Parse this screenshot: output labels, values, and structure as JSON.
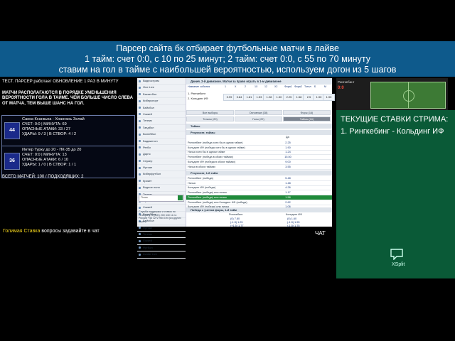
{
  "banner": {
    "line1": "Парсер сайта бк отбирает футбольные матчи в лайве",
    "line2": "1 тайм: счет 0:0, с 10 по 25 минут; 2 тайм: счет 0:0, с 55 по 70 минуту",
    "line3": "ставим на гол в тайме с наибольшей вероятностью, используем догон из 5 шагов"
  },
  "parser": {
    "status": "ТЕСТ. ПАРСЕР работает ОБНОВЛЕНИЕ 1 РАЗ В МИНУТУ",
    "note": "МАТЧИ РАСПОЛАГАЮТСЯ В ПОРЯДКЕ УМЕНЬШЕНИЯ ВЕРОЯТНОСТИ ГОЛА В ТАЙМЕ. ЧЕМ БОЛЬШЕ ЧИСЛО СЛЕВА ОТ МАТЧА, ТЕМ ВЫШЕ ШАНС НА ГОЛ.",
    "matches": [
      {
        "num": "44",
        "teams": "Санка Ксанкьоа - Хоангань Зелай",
        "score": "СЧЕТ: 0:0 | МИНУТА: 69",
        "attacks": "ОПАСНЫЕ АТАКИ: 33 / 27",
        "shots": "УДАРЫ: 9 / 3 | В СТВОР: 4 / 2"
      },
      {
        "num": "36",
        "teams": "Интер Турку до 20 - ПК-35 до 20",
        "score": "СЧЕТ: 0:0 | МИНУТА: 13",
        "attacks": "ОПАСНЫЕ АТАКИ: 6 / 10",
        "shots": "УДАРЫ: 1 / 0 | В СТВОР: 1 / 1"
      }
    ],
    "totals": "ВСЕГО МАТЧЕЙ: 100 / ПОДХОДЯЩИХ: 2"
  },
  "footer": {
    "name": "Голимая Ставка",
    "text": " вопросы задавайте в чат",
    "chat": "ЧАТ"
  },
  "browser": {
    "sidebar": [
      "Видеострим",
      "One Live",
      "Баскетбол",
      "Киберспорт",
      "Бейсбол",
      "Хоккей",
      "Теннис",
      "Гандбол",
      "Волейбол",
      "Бадминтон",
      "Регби",
      "Дартс",
      "Снукер",
      "Футзал",
      "Киберфутбол",
      "Крикет",
      "Водное поло",
      "Теннис",
      "Футбол",
      "Хоккей",
      "Волейбол",
      "Бейсбол",
      "Футзал",
      "Теннис",
      "Хоккей",
      "Футбол",
      "Avatar Live"
    ],
    "search": "Поиск",
    "support": "Служба поддержки и ставок по телефону: 8 (800) 200 340 11 по России +44 1272 964 194 (из других стран)",
    "header": "Дания. 2-й дивизион. Матчи за право играть в 1-м дивизионе",
    "event_label": "Название события",
    "team1": "1. Рингкебинг",
    "team2": "2. Кольдинг ИФ",
    "col_heads": [
      "1",
      "X",
      "2",
      "1X",
      "12",
      "X2",
      "Фора1",
      "Фора2",
      "Тотал",
      "Б",
      "М"
    ],
    "odds": [
      "3.99",
      "3.84",
      "1.81",
      "1.53",
      "1.28",
      "1.30",
      "2.25",
      "1.58",
      "2.5",
      "1.90",
      "1.90"
    ],
    "tabs1": [
      "Все выборы",
      "Основные (28)",
      "Форы (16)"
    ],
    "tabs2": [
      "Тоталы (20)",
      "Голы (22)",
      "Таймы (16)"
    ],
    "section1": "Таймы",
    "section2": "Результат, таймы",
    "col_da": "Да",
    "rows1": [
      {
        "label": "Рингкебинг (победа хотя бы в одном тайме)",
        "val": "2.25"
      },
      {
        "label": "Кольдинг ИФ (победа хотя бы в одном тайме)",
        "val": "1.90"
      },
      {
        "label": "Ничья хотя бы в одном тайме",
        "val": "1.24"
      },
      {
        "label": "Рингкебинг (победа в обоих таймах)",
        "val": "15.50"
      },
      {
        "label": "Кольдинг ИФ (победа в обоих таймах)",
        "val": "9.00"
      },
      {
        "label": "Ничья в обоих таймах",
        "val": "3.55"
      }
    ],
    "section3": "Результат, 1-й тайм",
    "rows2": [
      {
        "label": "Рингкебинг (победа)",
        "val": "5.48",
        "hi": false
      },
      {
        "label": "Ничья",
        "val": "1.48",
        "hi": false
      },
      {
        "label": "Кольдинг ИФ (победа)",
        "val": "4.26",
        "hi": false
      },
      {
        "label": "Рингкебинг (победа) или ничья",
        "val": "1.17",
        "hi": false
      },
      {
        "label": "Рингкебинг (победа) или ничья",
        "val": "1.58",
        "hi": true
      },
      {
        "label": "Рингкебинг (победа) или Кольдинг ИФ (победа)",
        "val": "2.62",
        "hi": false
      },
      {
        "label": "Кольдинг ИФ (победа) или ничья",
        "val": "1.06",
        "hi": false
      }
    ],
    "section4": "Победа с учетом форы, 1-й тайм",
    "fora_heads": [
      "Рингкебинг",
      "Кольдинг ИФ"
    ],
    "fora_rows": [
      [
        "(0) 7.80",
        "(0) 1.60"
      ],
      [
        "(-1.5) 1.25",
        "(-1.5) 1.95"
      ],
      [
        "(+1.5) 1.77",
        "(-1.5) 1.75"
      ]
    ]
  },
  "pitch": {
    "team": "Рингкебинг",
    "score": "0:0"
  },
  "bets": {
    "heading": "ТЕКУЩИЕ СТАВКИ СТРИМА:",
    "item": "1. Рингкебинг - Кольдинг ИФ",
    "brand": "XSplit"
  }
}
